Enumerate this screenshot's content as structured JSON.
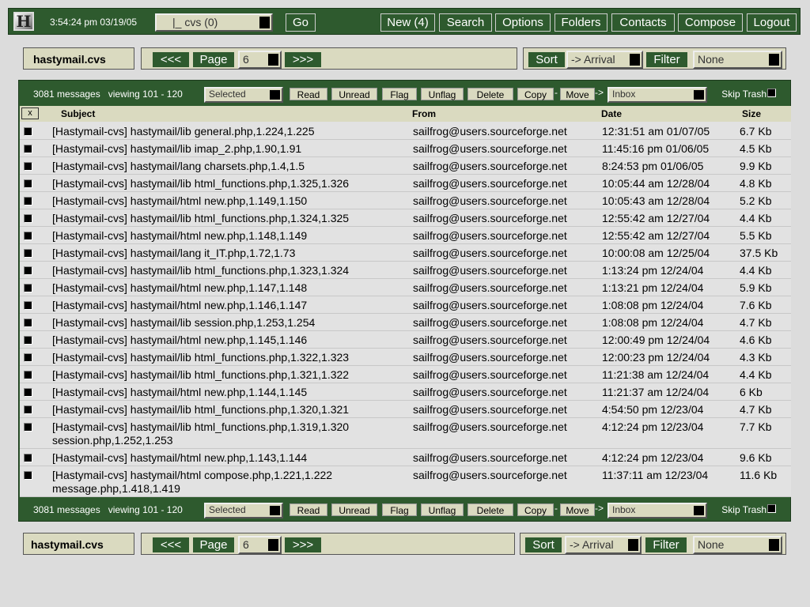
{
  "top": {
    "clock": "3:54:24 pm 03/19/05",
    "folder_select": "|_ cvs  (0)",
    "go": "Go",
    "nav": [
      "New (4)",
      "Search",
      "Options",
      "Folders",
      "Contacts",
      "Compose",
      "Logout"
    ]
  },
  "folder": "hastymail.cvs",
  "pager": {
    "prev": "<<<",
    "page_label": "Page",
    "page": "6",
    "next": ">>>"
  },
  "sorter": {
    "sort_label": "Sort",
    "sort_value": "-> Arrival",
    "filter_label": "Filter",
    "filter_value": "None"
  },
  "actions": {
    "count": "3081 messages",
    "viewing": "viewing 101 - 120",
    "selected": "Selected",
    "buttons": [
      "Read",
      "Unread",
      "Flag",
      "Unflag",
      "Delete",
      "Copy"
    ],
    "dash": "-",
    "move": "Move",
    "arrow": "->",
    "target": "Inbox",
    "skip_trash": "Skip Trash"
  },
  "columns": {
    "x": "x",
    "subject": "Subject",
    "from": "From",
    "date": "Date",
    "size": "Size"
  },
  "messages": [
    {
      "subject": "[Hastymail-cvs] hastymail/lib general.php,1.224,1.225",
      "from": "sailfrog@users.sourceforge.net",
      "date": "12:31:51 am 01/07/05",
      "size": "6.7 Kb"
    },
    {
      "subject": "[Hastymail-cvs] hastymail/lib imap_2.php,1.90,1.91",
      "from": "sailfrog@users.sourceforge.net",
      "date": "11:45:16 pm 01/06/05",
      "size": "4.5 Kb"
    },
    {
      "subject": "[Hastymail-cvs] hastymail/lang charsets.php,1.4,1.5",
      "from": "sailfrog@users.sourceforge.net",
      "date": "8:24:53 pm 01/06/05",
      "size": "9.9 Kb"
    },
    {
      "subject": "[Hastymail-cvs] hastymail/lib html_functions.php,1.325,1.326",
      "from": "sailfrog@users.sourceforge.net",
      "date": "10:05:44 am 12/28/04",
      "size": "4.8 Kb"
    },
    {
      "subject": "[Hastymail-cvs] hastymail/html new.php,1.149,1.150",
      "from": "sailfrog@users.sourceforge.net",
      "date": "10:05:43 am 12/28/04",
      "size": "5.2 Kb"
    },
    {
      "subject": "[Hastymail-cvs] hastymail/lib html_functions.php,1.324,1.325",
      "from": "sailfrog@users.sourceforge.net",
      "date": "12:55:42 am 12/27/04",
      "size": "4.4 Kb"
    },
    {
      "subject": "[Hastymail-cvs] hastymail/html new.php,1.148,1.149",
      "from": "sailfrog@users.sourceforge.net",
      "date": "12:55:42 am 12/27/04",
      "size": "5.5 Kb"
    },
    {
      "subject": "[Hastymail-cvs] hastymail/lang it_IT.php,1.72,1.73",
      "from": "sailfrog@users.sourceforge.net",
      "date": "10:00:08 am 12/25/04",
      "size": "37.5 Kb"
    },
    {
      "subject": "[Hastymail-cvs] hastymail/lib html_functions.php,1.323,1.324",
      "from": "sailfrog@users.sourceforge.net",
      "date": "1:13:24 pm 12/24/04",
      "size": "4.4 Kb"
    },
    {
      "subject": "[Hastymail-cvs] hastymail/html new.php,1.147,1.148",
      "from": "sailfrog@users.sourceforge.net",
      "date": "1:13:21 pm 12/24/04",
      "size": "5.9 Kb"
    },
    {
      "subject": "[Hastymail-cvs] hastymail/html new.php,1.146,1.147",
      "from": "sailfrog@users.sourceforge.net",
      "date": "1:08:08 pm 12/24/04",
      "size": "7.6 Kb"
    },
    {
      "subject": "[Hastymail-cvs] hastymail/lib session.php,1.253,1.254",
      "from": "sailfrog@users.sourceforge.net",
      "date": "1:08:08 pm 12/24/04",
      "size": "4.7 Kb"
    },
    {
      "subject": "[Hastymail-cvs] hastymail/html new.php,1.145,1.146",
      "from": "sailfrog@users.sourceforge.net",
      "date": "12:00:49 pm 12/24/04",
      "size": "4.6 Kb"
    },
    {
      "subject": "[Hastymail-cvs] hastymail/lib html_functions.php,1.322,1.323",
      "from": "sailfrog@users.sourceforge.net",
      "date": "12:00:23 pm 12/24/04",
      "size": "4.3 Kb"
    },
    {
      "subject": "[Hastymail-cvs] hastymail/lib html_functions.php,1.321,1.322",
      "from": "sailfrog@users.sourceforge.net",
      "date": "11:21:38 am 12/24/04",
      "size": "4.4 Kb"
    },
    {
      "subject": "[Hastymail-cvs] hastymail/html new.php,1.144,1.145",
      "from": "sailfrog@users.sourceforge.net",
      "date": "11:21:37 am 12/24/04",
      "size": "6 Kb"
    },
    {
      "subject": "[Hastymail-cvs] hastymail/lib html_functions.php,1.320,1.321",
      "from": "sailfrog@users.sourceforge.net",
      "date": "4:54:50 pm 12/23/04",
      "size": "4.7 Kb"
    },
    {
      "subject": "[Hastymail-cvs] hastymail/lib html_functions.php,1.319,1.320 session.php,1.252,1.253",
      "from": "sailfrog@users.sourceforge.net",
      "date": "4:12:24 pm 12/23/04",
      "size": "7.7 Kb"
    },
    {
      "subject": "[Hastymail-cvs] hastymail/html new.php,1.143,1.144",
      "from": "sailfrog@users.sourceforge.net",
      "date": "4:12:24 pm 12/23/04",
      "size": "9.6 Kb"
    },
    {
      "subject": "[Hastymail-cvs] hastymail/html compose.php,1.221,1.222 message.php,1.418,1.419",
      "from": "sailfrog@users.sourceforge.net",
      "date": "11:37:11 am 12/23/04",
      "size": "11.6 Kb"
    }
  ]
}
